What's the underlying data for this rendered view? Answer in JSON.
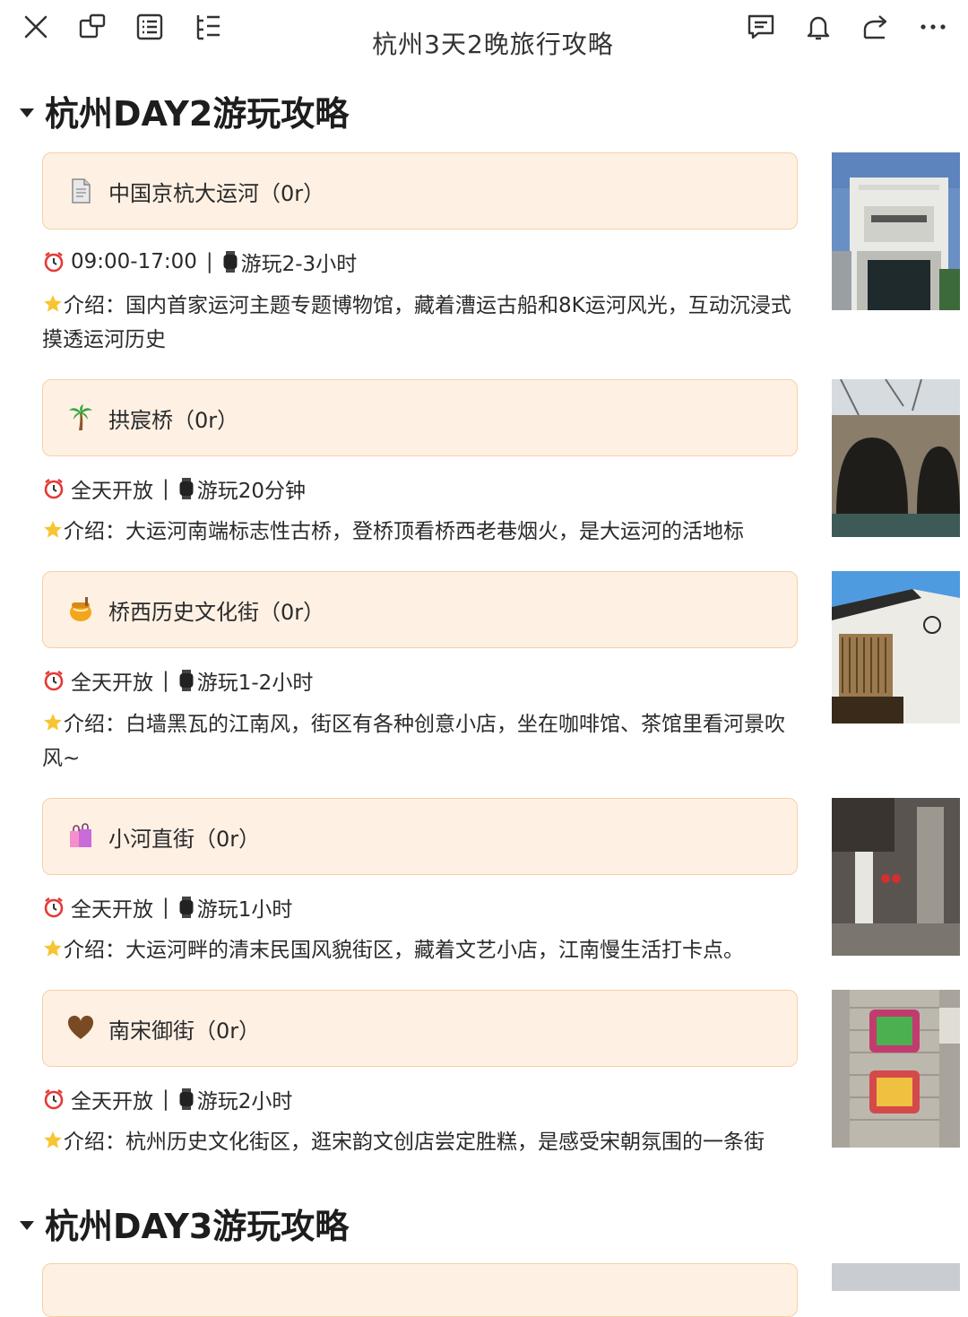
{
  "toolbar": {
    "title": "杭州3天2晚旅行攻略",
    "left_icons": [
      "close-icon",
      "window-icon",
      "outline-icon",
      "list-tree-icon"
    ],
    "right_icons": [
      "comment-icon",
      "bell-icon",
      "share-icon",
      "more-icon"
    ]
  },
  "sections": [
    {
      "heading": "杭州DAY2游玩攻略",
      "items": [
        {
          "icon": "document-icon",
          "title": "中国京杭大运河（0r）",
          "hours": "09:00-17:00",
          "duration": "游玩2-3小时",
          "intro": "介绍：国内首家运河主题专题博物馆，藏着漕运古船和8K运河风光，互动沉浸式摸透运河历史"
        },
        {
          "icon": "palm-tree-icon",
          "title": "拱宸桥（0r）",
          "hours": "全天开放",
          "duration": "游玩20分钟",
          "intro": "介绍：大运河南端标志性古桥，登桥顶看桥西老巷烟火，是大运河的活地标"
        },
        {
          "icon": "honey-pot-icon",
          "title": "桥西历史文化街（0r）",
          "hours": "全天开放",
          "duration": "游玩1-2小时",
          "intro": "介绍：白墙黑瓦的江南风，街区有各种创意小店，坐在咖啡馆、茶馆里看河景吹风~"
        },
        {
          "icon": "shopping-bags-icon",
          "title": "小河直街（0r）",
          "hours": "全天开放",
          "duration": "游玩1小时",
          "intro": "介绍：大运河畔的清末民国风貌街区，藏着文艺小店，江南慢生活打卡点。"
        },
        {
          "icon": "brown-heart-icon",
          "title": "南宋御街（0r）",
          "hours": "全天开放",
          "duration": "游玩2小时",
          "intro": "介绍：杭州历史文化街区，逛宋韵文创店尝定胜糕，是感受宋朝氛围的一条街"
        }
      ]
    },
    {
      "heading": "杭州DAY3游玩攻略",
      "items": []
    }
  ],
  "colors": {
    "card_bg": "#fef1e4",
    "card_border": "#f6cfa7",
    "text": "#2a2a2a"
  }
}
